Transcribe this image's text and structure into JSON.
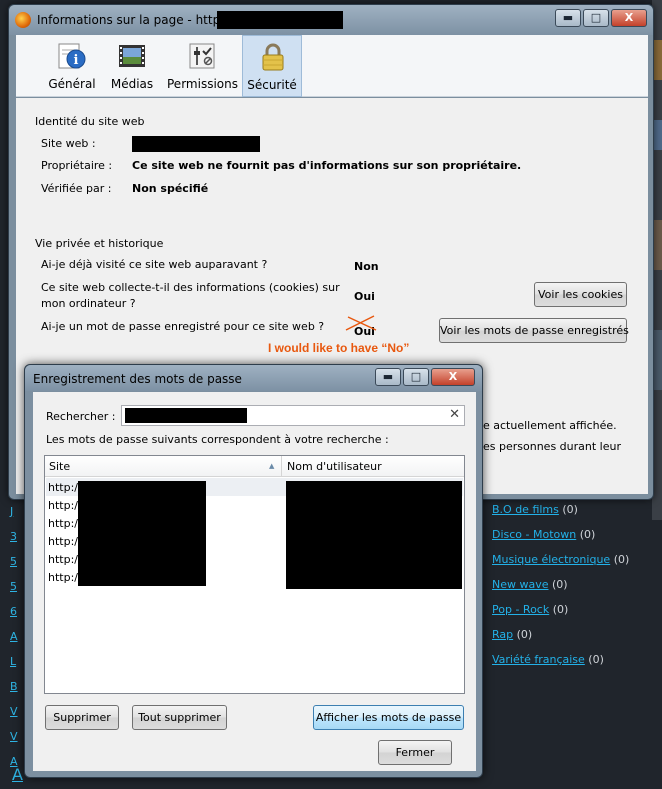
{
  "background_page": {
    "left_links": [
      "J",
      "3",
      "5",
      "5",
      "6",
      "A",
      "L",
      "B",
      "V",
      "V",
      "A",
      "R"
    ],
    "genres": [
      {
        "name": "B.O de films",
        "count": "(0)"
      },
      {
        "name": "Disco - Motown",
        "count": "(0)"
      },
      {
        "name": "Musique électronique",
        "count": "(0)"
      },
      {
        "name": "New wave",
        "count": "(0)"
      },
      {
        "name": "Pop - Rock",
        "count": "(0)"
      },
      {
        "name": "Rap",
        "count": "(0)"
      },
      {
        "name": "Variété française",
        "count": "(0)"
      }
    ],
    "bottom_link": "A"
  },
  "info_window": {
    "title": "Informations sur la page - http://",
    "controls": {
      "minimize": "▬",
      "maximize": "□",
      "close": "X"
    },
    "tabs": [
      {
        "label": "Général",
        "icon": "info-icon"
      },
      {
        "label": "Médias",
        "icon": "media-icon"
      },
      {
        "label": "Permissions",
        "icon": "permissions-icon"
      },
      {
        "label": "Sécurité",
        "icon": "lock-icon",
        "selected": true
      }
    ],
    "identity": {
      "title": "Identité du site web",
      "website_label": "Site web :",
      "owner_label": "Propriétaire :",
      "owner_value": "Ce site web ne fournit pas d'informations sur son propriétaire.",
      "verified_label": "Vérifiée par :",
      "verified_value": "Non spécifié"
    },
    "privacy": {
      "title": "Vie privée et historique",
      "visited_question": "Ai-je déjà visité ce site web auparavant ?",
      "visited_answer": "Non",
      "cookies_question_1": "Ce site web collecte-t-il des informations (cookies) sur",
      "cookies_question_2": "mon ordinateur ?",
      "cookies_answer": "Oui",
      "cookies_button": "Voir les cookies",
      "passwords_question": "Ai-je un mot de passe enregistré pour ce site web ?",
      "passwords_answer": "Oui",
      "passwords_button": "Voir les mots de passe enregistrés"
    },
    "annotation": "I would like to have “No”",
    "tech_fragment_1": "e actuellement affichée.",
    "tech_fragment_2": "es personnes durant leur"
  },
  "password_window": {
    "title": "Enregistrement des mots de passe",
    "controls": {
      "minimize": "▬",
      "maximize": "□",
      "close": "X"
    },
    "search_label": "Rechercher :",
    "match_label": "Les mots de passe suivants correspondent à votre recherche :",
    "columns": {
      "site": "Site",
      "username": "Nom d'utilisateur"
    },
    "rows": [
      {
        "site": "http://",
        "selected": true
      },
      {
        "site": "http://"
      },
      {
        "site": "http://"
      },
      {
        "site": "http://"
      },
      {
        "site": "http://"
      },
      {
        "site": "http://"
      }
    ],
    "buttons": {
      "delete": "Supprimer",
      "delete_all": "Tout supprimer",
      "show_passwords": "Afficher les mots de passe",
      "close": "Fermer"
    }
  },
  "colors": {
    "link": "#23b1e8",
    "annotation": "#e8580f",
    "selected_tab": "#cfe0f2"
  }
}
